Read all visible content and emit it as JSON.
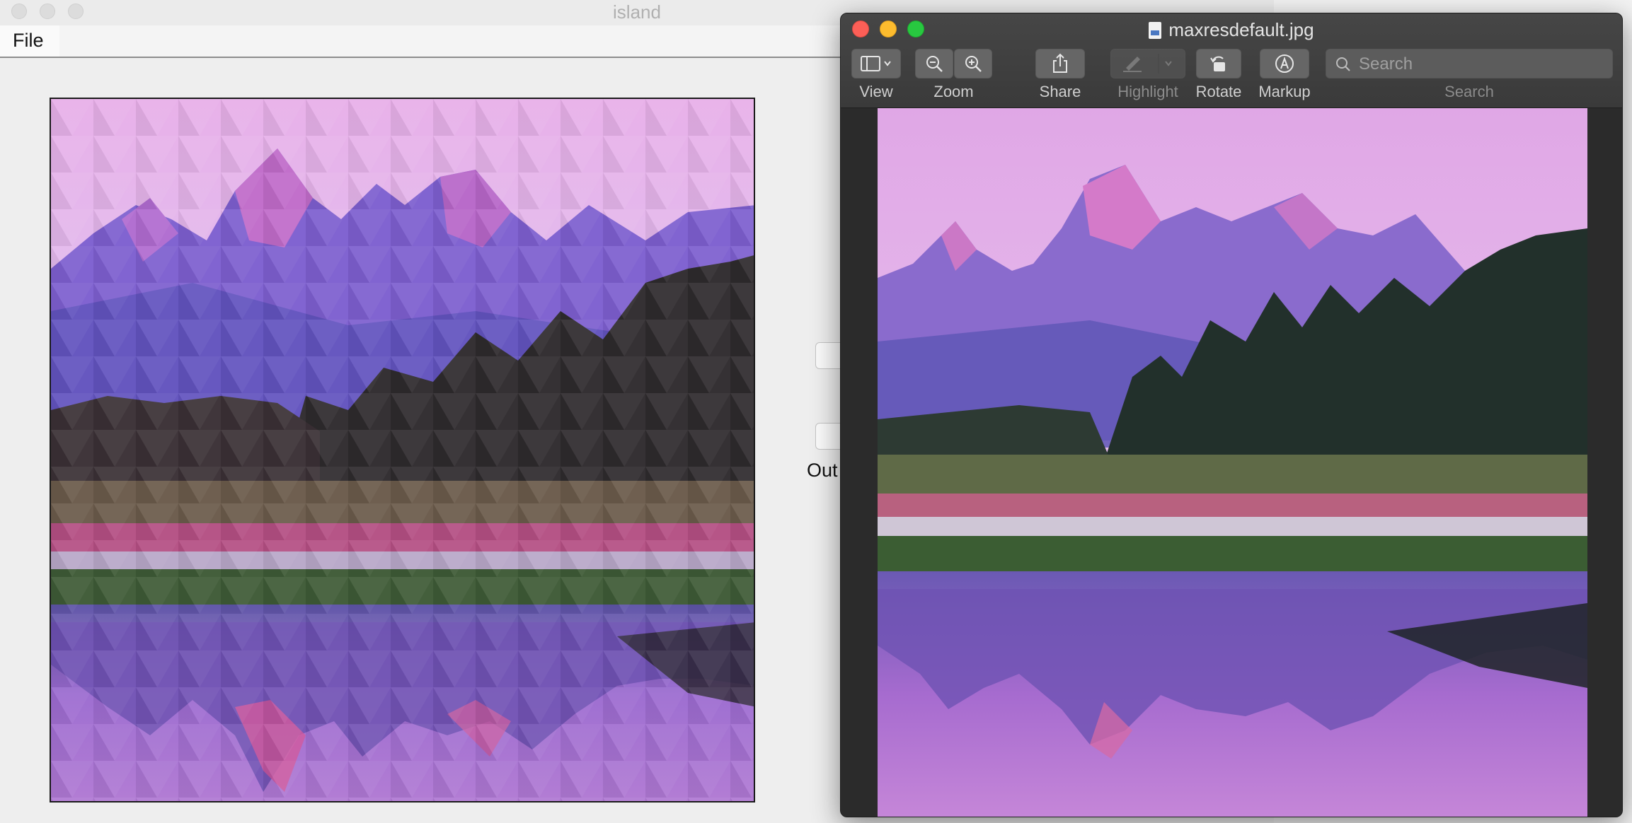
{
  "app": {
    "title": "island",
    "menu": {
      "file_label": "File"
    },
    "output_label": "Out"
  },
  "preview": {
    "title": "maxresdefault.jpg",
    "toolbar": {
      "view_label": "View",
      "zoom_label": "Zoom",
      "share_label": "Share",
      "highlight_label": "Highlight",
      "rotate_label": "Rotate",
      "markup_label": "Markup",
      "search_label": "Search",
      "search_placeholder": "Search"
    }
  },
  "colors": {
    "close": "#fc5f57",
    "minimize": "#fdbc2e",
    "maximize": "#28c840",
    "sky": "#e5b7ee",
    "mountain": "#8b63c9",
    "trees": "#2f2b2c",
    "water": "#9a6fc9"
  }
}
